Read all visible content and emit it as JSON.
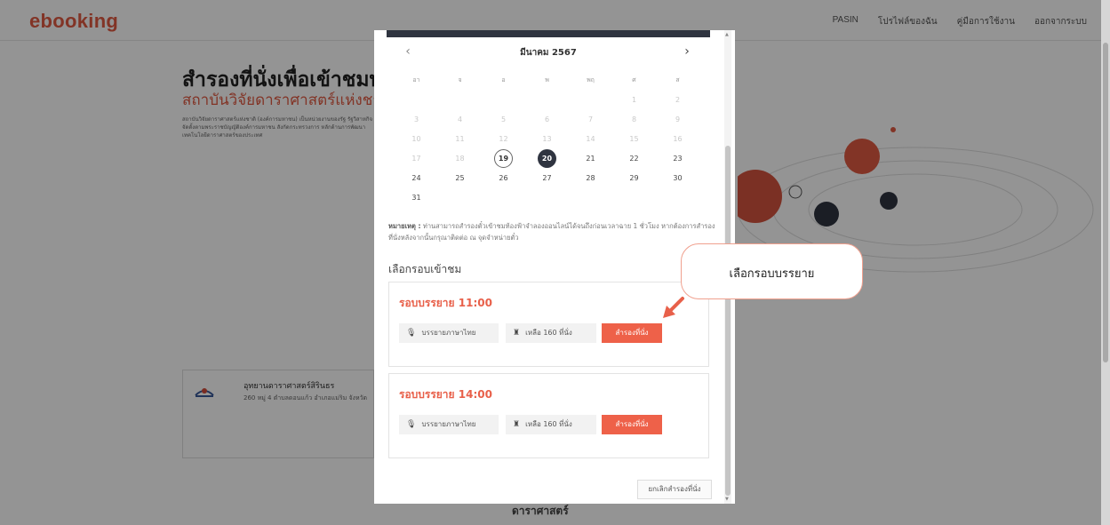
{
  "header": {
    "logo": "ebooking",
    "nav": [
      "PASIN",
      "โปรไฟล์ของฉัน",
      "คู่มือการใช้งาน",
      "ออกจากระบบ"
    ]
  },
  "background": {
    "title": "สำรองที่นั่งเพื่อเข้าชมท้อง",
    "subtitle": "สถาบันวิจัยดาราศาสตร์แห่งชาติ (อ",
    "description": "สถาบันวิจัยดาราศาสตร์แห่งชาติ (องค์การมหาชน) เป็นหน่วยงานของรัฐ รัฐวิสาหกิจ จัดตั้งตามพระราชบัญญัติองค์การมหาชน สังกัดกระทรวงการ หลักด้านการพัฒนาเทคโนโลยีดาราศาสตร์ของประเทศ",
    "venue_name": "อุทยานดาราศาสตร์สิรินธร",
    "venue_address": "260 หมู่ 4 ตำบลดอนแก้ว อำเภอแม่ริม จังหวัด",
    "bottom_peek": "ดาราศาสตร์"
  },
  "calendar": {
    "month_label": "มีนาคม 2567",
    "prev_icon": "‹",
    "next_icon": "›",
    "weekdays": [
      "อา",
      "จ",
      "อ",
      "พ",
      "พฤ",
      "ศ",
      "ส"
    ],
    "today": 19,
    "selected": 20
  },
  "note": {
    "label": "หมายเหตุ :",
    "text": "ท่านสามารถสำรองตั๋วเข้าชมท้องฟ้าจำลองออนไลน์ได้จนถึงก่อนเวลาฉาย 1 ชั่วโมง หากต้องการสำรองที่นั่งหลังจากนั้นกรุณาติดต่อ ณ จุดจำหน่ายตั๋ว"
  },
  "section_title": "เลือกรอบเข้าชม",
  "rounds": [
    {
      "title": "รอบบรรยาย 11:00",
      "language": "บรรยายภาษาไทย",
      "seats": "เหลือ 160 ที่นั่ง",
      "book_label": "สำรองที่นั่ง"
    },
    {
      "title": "รอบบรรยาย 14:00",
      "language": "บรรยายภาษาไทย",
      "seats": "เหลือ 160 ที่นั่ง",
      "book_label": "สำรองที่นั่ง"
    }
  ],
  "cancel_label": "ยกเลิกสำรองที่นั่ง",
  "callout": {
    "text": "เลือกรอบบรรยาย"
  },
  "icons": {
    "language": "microphone-icon",
    "seats": "seat-icon",
    "arrow": "arrow-pointer-icon"
  },
  "colors": {
    "accent": "#ee6149",
    "brand": "#e05a42",
    "selected_day": "#2f3440"
  }
}
